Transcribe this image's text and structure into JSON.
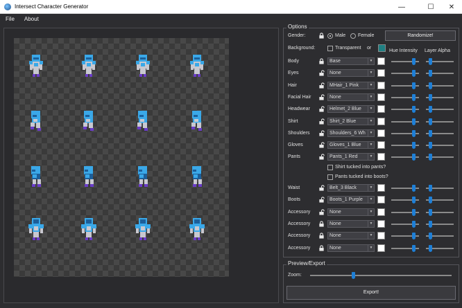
{
  "window": {
    "title": "Intersect Character Generator",
    "minimize": "—",
    "maximize": "☐",
    "close": "✕"
  },
  "menu": [
    "File",
    "About"
  ],
  "options": {
    "title": "Options",
    "gender": {
      "label": "Gender:",
      "male": "Male",
      "female": "Female",
      "selected": "Male"
    },
    "randomize": "Randomize!",
    "background": {
      "label": "Background:",
      "transparent": "Transparent",
      "or": "or",
      "color": "#1f7f82"
    },
    "headers": {
      "hue": "Hue Intensity",
      "alpha": "Layer Alpha"
    },
    "rows": [
      {
        "label": "Body",
        "value": "Base",
        "locked": true,
        "hue": 0.85,
        "alpha": 0.1
      },
      {
        "label": "Eyes",
        "value": "None",
        "locked": false,
        "hue": 0.85,
        "alpha": 0.1
      },
      {
        "label": "Hair",
        "value": "MHair_1 Pink",
        "locked": false,
        "hue": 0.85,
        "alpha": 0.1
      },
      {
        "label": "Facial Hair",
        "value": "None",
        "locked": false,
        "hue": 0.85,
        "alpha": 0.1
      },
      {
        "label": "Headwear",
        "value": "Helmet_2 Blue",
        "locked": false,
        "hue": 0.85,
        "alpha": 0.1
      },
      {
        "label": "Shirt",
        "value": "Shirt_2 Blue",
        "locked": false,
        "hue": 0.85,
        "alpha": 0.1
      },
      {
        "label": "Shoulders",
        "value": "Shoulders_6 Wh",
        "locked": false,
        "hue": 0.85,
        "alpha": 0.1
      },
      {
        "label": "Gloves",
        "value": "Gloves_1 Blue",
        "locked": false,
        "hue": 0.85,
        "alpha": 0.1
      },
      {
        "label": "Pants",
        "value": "Pants_1 Red",
        "locked": false,
        "hue": 0.85,
        "alpha": 0.1
      }
    ],
    "checks": [
      "Shirt tucked into pants?",
      "Pants tucked into boots?"
    ],
    "rows2": [
      {
        "label": "Waist",
        "value": "Belt_3 Black",
        "locked": false,
        "hue": 0.85,
        "alpha": 0.1
      },
      {
        "label": "Boots",
        "value": "Boots_1 Purple",
        "locked": false,
        "hue": 0.85,
        "alpha": 0.1
      },
      {
        "label": "Accessory",
        "value": "None",
        "locked": false,
        "hue": 0.85,
        "alpha": 0.1
      },
      {
        "label": "Accessory",
        "value": "None",
        "locked": true,
        "hue": 0.85,
        "alpha": 0.1
      },
      {
        "label": "Accessory",
        "value": "None",
        "locked": true,
        "hue": 0.85,
        "alpha": 0.1
      },
      {
        "label": "Accessory",
        "value": "None",
        "locked": true,
        "hue": 0.85,
        "alpha": 0.1
      }
    ]
  },
  "export": {
    "title": "Preview/Export",
    "zoom_label": "Zoom:",
    "zoom_level": 0.3,
    "button": "Export!"
  },
  "colors": {
    "accent": "#1e7fd6",
    "armor": "#3aa8e8",
    "armor_dark": "#1c5f9a",
    "silver": "#c8c8d0",
    "purple": "#6a3cc8"
  }
}
